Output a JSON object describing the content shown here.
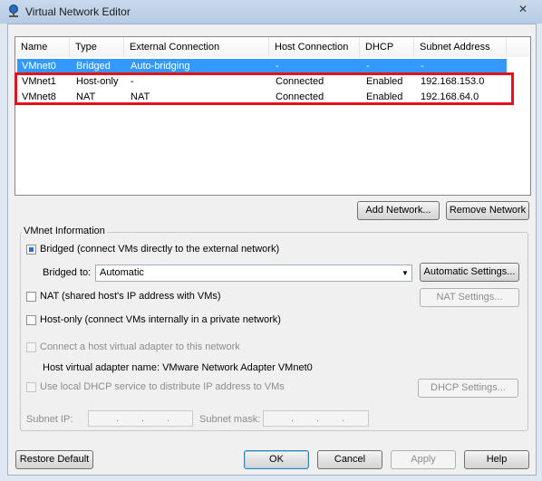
{
  "window": {
    "title": "Virtual Network Editor",
    "close_glyph": "✕"
  },
  "list": {
    "columns": [
      "Name",
      "Type",
      "External Connection",
      "Host Connection",
      "DHCP",
      "Subnet Address"
    ],
    "rows": [
      {
        "name": "VMnet0",
        "type": "Bridged",
        "external": "Auto-bridging",
        "host": "-",
        "dhcp": "-",
        "subnet": "-"
      },
      {
        "name": "VMnet1",
        "type": "Host-only",
        "external": "-",
        "host": "Connected",
        "dhcp": "Enabled",
        "subnet": "192.168.153.0"
      },
      {
        "name": "VMnet8",
        "type": "NAT",
        "external": "NAT",
        "host": "Connected",
        "dhcp": "Enabled",
        "subnet": "192.168.64.0"
      }
    ]
  },
  "buttons": {
    "add_network": "Add Network...",
    "remove_network": "Remove Network",
    "automatic_settings": "Automatic Settings...",
    "nat_settings": "NAT Settings...",
    "dhcp_settings": "DHCP Settings...",
    "restore_default": "Restore Default",
    "ok": "OK",
    "cancel": "Cancel",
    "apply": "Apply",
    "help": "Help"
  },
  "info": {
    "group_label": "VMnet Information",
    "bridged_label": "Bridged (connect VMs directly to the external network)",
    "bridged_to_label": "Bridged to:",
    "bridged_to_value": "Automatic",
    "nat_label": "NAT (shared host's IP address with VMs)",
    "hostonly_label": "Host-only (connect VMs internally in a private network)",
    "connect_adapter_label": "Connect a host virtual adapter to this network",
    "adapter_name_label": "Host virtual adapter name: VMware Network Adapter VMnet0",
    "dhcp_label": "Use local DHCP service to distribute IP address to VMs",
    "subnet_ip_label": "Subnet IP:",
    "subnet_mask_label": "Subnet mask:",
    "ip_dot": "."
  },
  "colors": {
    "selection": "#3399ff",
    "highlight_box": "#e8101c"
  }
}
